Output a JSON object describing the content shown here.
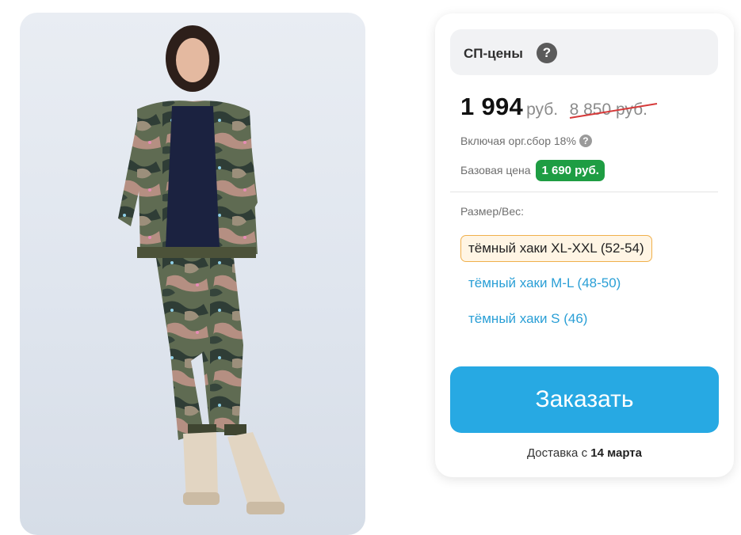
{
  "product_image": {
    "alt": "camo tracksuit model photo"
  },
  "sp_prices": {
    "label": "СП-цены",
    "help_icon": "?"
  },
  "price": {
    "current": "1 994",
    "currency": "руб.",
    "old": "8 850 руб."
  },
  "fees": {
    "text": "Включая орг.сбор 18%",
    "help_icon": "?"
  },
  "base_price": {
    "label": "Базовая цена",
    "value": "1 690 руб."
  },
  "sizes": {
    "label": "Размер/Вес:",
    "options": [
      "тёмный хаки XL-XXL (52-54)",
      "тёмный хаки M-L (48-50)",
      "тёмный хаки S (46)"
    ],
    "selected_index": 0
  },
  "order_button": {
    "label": "Заказать"
  },
  "delivery": {
    "prefix": "Доставка с",
    "date": "14 марта"
  },
  "colors": {
    "accent": "#27a9e3",
    "base_badge": "#1e9d43",
    "selected_bg": "#fff5e4",
    "selected_border": "#f0b04c",
    "strike": "#d63a3a"
  }
}
